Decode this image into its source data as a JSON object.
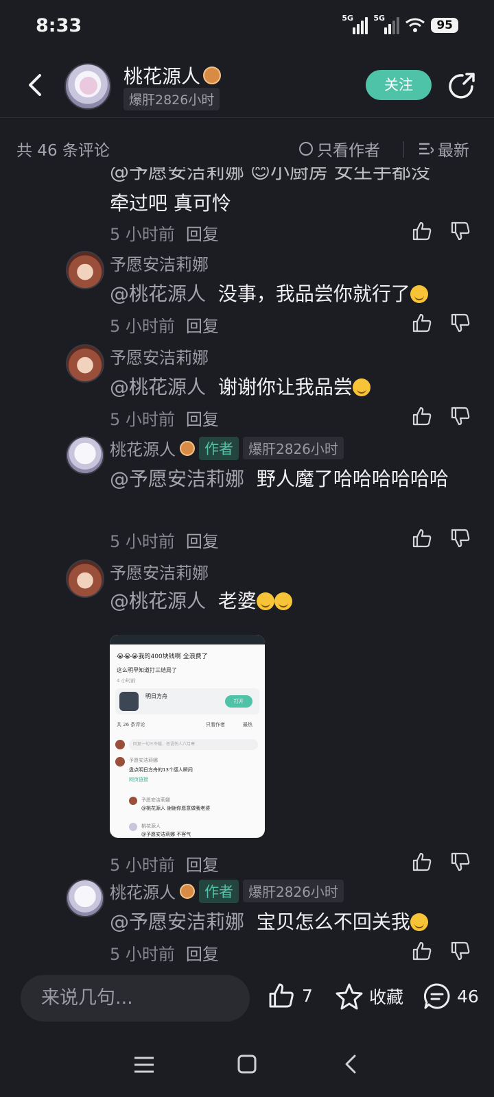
{
  "status_bar": {
    "time": "8:33",
    "signal1": "5G",
    "signal2": "5G",
    "battery": "95"
  },
  "header": {
    "username": "桃花源人",
    "hours_badge": "爆肝2826小时",
    "follow_label": "关注"
  },
  "filter": {
    "count_label": "共 46 条评论",
    "only_author_label": "只看作者",
    "sort_label": "最新"
  },
  "comments": [
    {
      "partial_top": "@予愿安洁莉娜 😊小厨房 女生手都没",
      "text": "牵过吧 真可怜",
      "time": "5 小时前",
      "reply": "回复"
    },
    {
      "name": "予愿安洁莉娜",
      "mention": "@桃花源人",
      "text": "没事，我品尝你就行了",
      "time": "5 小时前",
      "reply": "回复"
    },
    {
      "name": "予愿安洁莉娜",
      "mention": "@桃花源人",
      "text": "谢谢你让我品尝",
      "time": "5 小时前",
      "reply": "回复"
    },
    {
      "name": "桃花源人",
      "author_tag": "作者",
      "hours_tag": "爆肝2826小时",
      "mention": "@予愿安洁莉娜",
      "text": "野人魔了哈哈哈哈哈哈",
      "time": "5 小时前",
      "reply": "回复"
    },
    {
      "name": "予愿安洁莉娜",
      "mention": "@桃花源人",
      "text": "老婆",
      "time": "5 小时前",
      "reply": "回复",
      "embedded": {
        "title": "😭😭😭我的400块钱啊 全浪费了",
        "sub": "这么明早知道打三结局了",
        "age": "4 小时前",
        "game_name": "明日方舟",
        "open_label": "打开",
        "count_label": "共 26 条评论",
        "only_author": "只看作者",
        "sort": "最热",
        "input_placeholder": "回复一句三冬暖，恶语伤人六月寒",
        "c1_name": "予愿安洁莉娜",
        "c1_text": "盘点明日方舟的13个感人瞬间",
        "c1_link": "网页链接",
        "c2_name": "予愿安洁莉娜",
        "c2_text": "@桃花源人 谢谢你愿意做我老婆",
        "c3_name": "桃花源人",
        "c3_text": "@予愿安洁莉娜 不客气"
      }
    },
    {
      "name": "桃花源人",
      "author_tag": "作者",
      "hours_tag": "爆肝2826小时",
      "mention": "@予愿安洁莉娜",
      "text": "宝贝怎么不回关我",
      "time": "5 小时前",
      "reply": "回复"
    }
  ],
  "bottom_bar": {
    "input_placeholder": "来说几句...",
    "like_count": "7",
    "favorite_label": "收藏",
    "comment_count": "46"
  },
  "icons": [
    "back-arrow-icon",
    "share-icon",
    "thumb-up-icon",
    "thumb-down-icon",
    "star-icon",
    "comment-bubble-icon",
    "menu-icon",
    "home-square-icon",
    "nav-back-icon"
  ],
  "colors": {
    "background": "#1c1d22",
    "accent": "#4fc3a8",
    "text_primary": "#f0f0f2",
    "text_secondary": "#9a9aa2"
  }
}
